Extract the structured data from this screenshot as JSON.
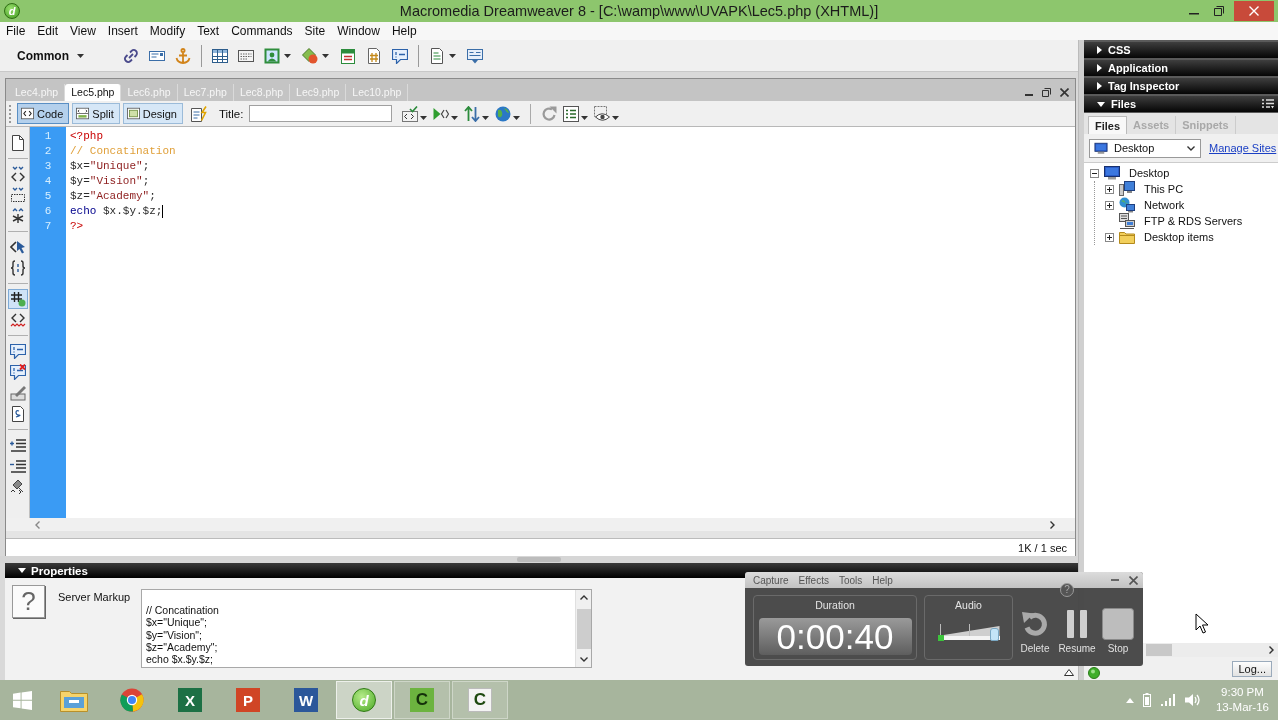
{
  "window": {
    "logo": "d",
    "title": "Macromedia Dreamweaver 8 - [C:\\wamp\\www\\UVAPK\\Lec5.php (XHTML)]"
  },
  "menu": [
    "File",
    "Edit",
    "View",
    "Insert",
    "Modify",
    "Text",
    "Commands",
    "Site",
    "Window",
    "Help"
  ],
  "insert_bar": {
    "category": "Common"
  },
  "document": {
    "tabs": [
      {
        "label": "Lec4.php",
        "selected": false
      },
      {
        "label": "Lec5.php",
        "selected": true
      },
      {
        "label": "Lec6.php",
        "selected": false
      },
      {
        "label": "Lec7.php",
        "selected": false
      },
      {
        "label": "Lec8.php",
        "selected": false
      },
      {
        "label": "Lec9.php",
        "selected": false
      },
      {
        "label": "Lec10.php",
        "selected": false
      }
    ],
    "views": [
      {
        "kind": "code",
        "label": "Code",
        "selected": true
      },
      {
        "kind": "split",
        "label": "Split",
        "selected": false
      },
      {
        "kind": "design",
        "label": "Design",
        "selected": false
      }
    ],
    "title_label": "Title:",
    "coding_toolbar": [
      [
        {
          "kind": "document",
          "selected": false
        }
      ],
      [
        {
          "kind": "collapse",
          "selected": false
        },
        {
          "kind": "collapse-box",
          "selected": false
        },
        {
          "kind": "expand",
          "selected": false
        }
      ],
      [
        {
          "kind": "select-parent",
          "selected": false
        },
        {
          "kind": "braces",
          "selected": false
        }
      ],
      [
        {
          "kind": "hash",
          "selected": true
        },
        {
          "kind": "tag-wavy",
          "selected": false
        }
      ],
      [
        {
          "kind": "comment",
          "selected": false
        },
        {
          "kind": "comment-remove",
          "selected": false
        },
        {
          "kind": "pen",
          "selected": false
        },
        {
          "kind": "snippet",
          "selected": false
        }
      ],
      [
        {
          "kind": "indent",
          "selected": false
        },
        {
          "kind": "outdent",
          "selected": false
        },
        {
          "kind": "format",
          "selected": false
        }
      ]
    ],
    "lines": [
      {
        "number": "1",
        "caret": false,
        "tokens": [
          {
            "kind": "delimiter",
            "text": "<?php"
          }
        ]
      },
      {
        "number": "2",
        "caret": false,
        "tokens": [
          {
            "kind": "comment",
            "text": "// Concatination"
          }
        ]
      },
      {
        "number": "3",
        "caret": false,
        "tokens": [
          {
            "kind": "variable",
            "text": "$x="
          },
          {
            "kind": "string",
            "text": "\"Unique\""
          },
          {
            "kind": "plain",
            "text": ";"
          }
        ]
      },
      {
        "number": "4",
        "caret": false,
        "tokens": [
          {
            "kind": "variable",
            "text": "$y="
          },
          {
            "kind": "string",
            "text": "\"Vision\""
          },
          {
            "kind": "plain",
            "text": ";"
          }
        ]
      },
      {
        "number": "5",
        "caret": false,
        "tokens": [
          {
            "kind": "variable",
            "text": "$z="
          },
          {
            "kind": "string",
            "text": "\"Academy\""
          },
          {
            "kind": "plain",
            "text": ";"
          }
        ]
      },
      {
        "number": "6",
        "caret": true,
        "tokens": [
          {
            "kind": "keyword",
            "text": "echo"
          },
          {
            "kind": "plain",
            "text": " $x.$y.$z;"
          }
        ]
      },
      {
        "number": "7",
        "caret": false,
        "tokens": [
          {
            "kind": "delimiter",
            "text": "?>"
          }
        ]
      }
    ],
    "status": "1K / 1 sec"
  },
  "properties": {
    "title": "Properties",
    "expanded": true,
    "icon": "?",
    "label": "Server Markup",
    "markup": [
      "// Concatination",
      "$x=\"Unique\";",
      "$y=\"Vision\";",
      "$z=\"Academy\";",
      "echo $x.$y.$z;"
    ]
  },
  "panels": [
    {
      "title": "CSS",
      "expanded": false
    },
    {
      "title": "Application",
      "expanded": false
    },
    {
      "title": "Tag Inspector",
      "expanded": false
    },
    {
      "title": "Files",
      "expanded": true
    }
  ],
  "files": {
    "tabs": [
      {
        "label": "Files",
        "selected": true
      },
      {
        "label": "Assets",
        "selected": false
      },
      {
        "label": "Snippets",
        "selected": false
      }
    ],
    "location": "Desktop",
    "link": "Manage Sites",
    "tree": [
      {
        "kind": "desktop",
        "label": "Desktop",
        "expanded": true,
        "children": [
          {
            "kind": "computer",
            "label": "This PC",
            "expanded": false
          },
          {
            "kind": "network",
            "label": "Network",
            "expanded": false
          },
          {
            "kind": "servers",
            "label": "FTP & RDS Servers"
          },
          {
            "kind": "folder",
            "label": "Desktop items",
            "expanded": false
          }
        ]
      }
    ],
    "log_button": "Log..."
  },
  "recorder": {
    "menu": [
      "Capture",
      "Effects",
      "Tools",
      "Help"
    ],
    "help": "?",
    "duration": {
      "label": "Duration",
      "value": "0:00:40"
    },
    "audio": {
      "label": "Audio",
      "level": 0.93
    },
    "buttons": [
      {
        "kind": "delete",
        "label": "Delete"
      },
      {
        "kind": "pause",
        "label": "Resume"
      },
      {
        "kind": "stop",
        "label": "Stop"
      }
    ]
  },
  "taskbar": {
    "apps": [
      {
        "kind": "folder",
        "running": false,
        "selected": false
      },
      {
        "kind": "wheel",
        "running": false,
        "selected": false
      },
      {
        "kind": "sheet",
        "glyph": "X",
        "running": false,
        "selected": false
      },
      {
        "kind": "slides",
        "glyph": "P",
        "running": false,
        "selected": false
      },
      {
        "kind": "writer",
        "glyph": "W",
        "running": false,
        "selected": false
      },
      {
        "kind": "disc",
        "glyph": "d",
        "running": true,
        "selected": true
      },
      {
        "kind": "square",
        "glyph": "C",
        "running": true,
        "selected": false
      },
      {
        "kind": "paper",
        "glyph": "C",
        "running": true,
        "selected": false
      }
    ],
    "time": "9:30 PM",
    "date": "13-Mar-16"
  }
}
